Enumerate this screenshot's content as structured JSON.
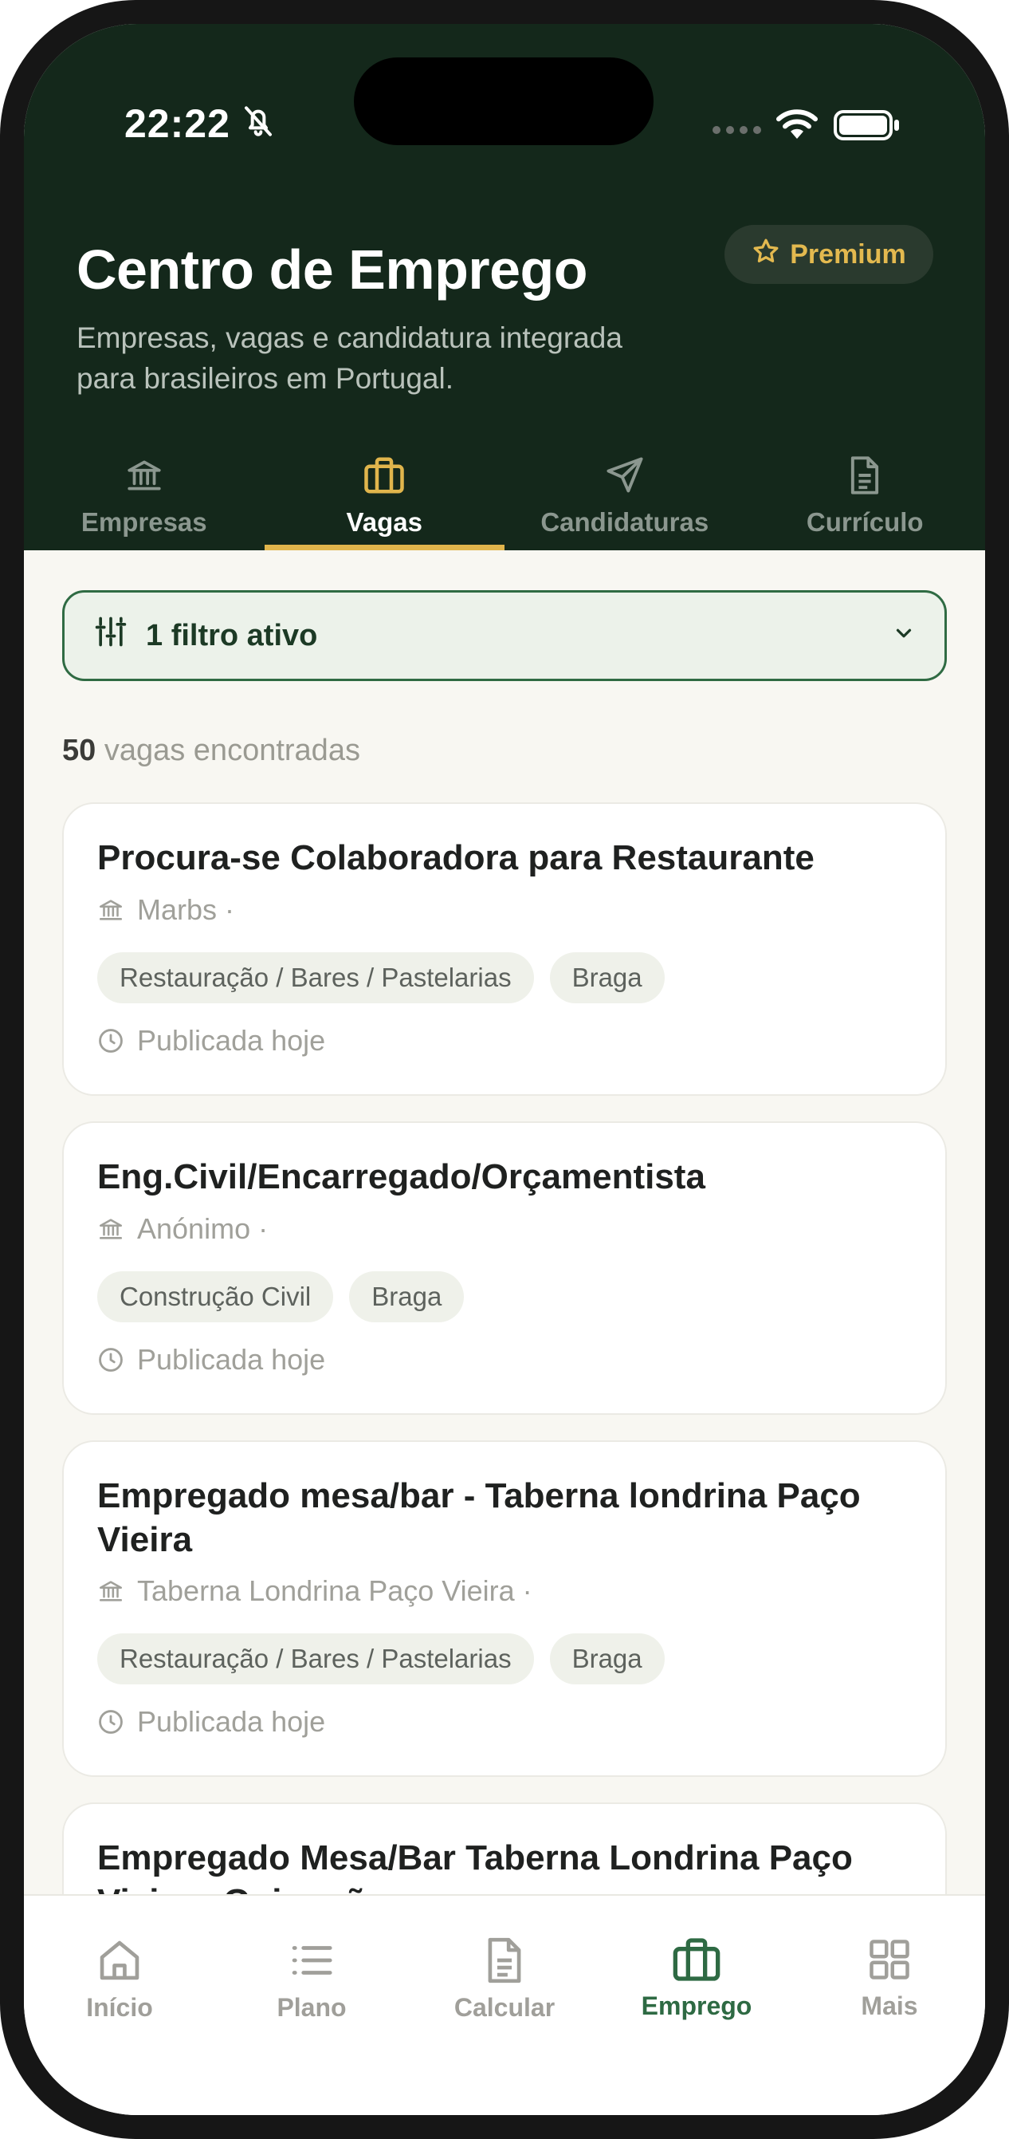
{
  "status_bar": {
    "time": "22:22"
  },
  "header": {
    "title": "Centro de Emprego",
    "subtitle": "Empresas, vagas e candidatura integrada para brasileiros em Portugal.",
    "premium_label": "Premium"
  },
  "tabs": [
    {
      "label": "Empresas",
      "icon": "bank-icon",
      "active": false
    },
    {
      "label": "Vagas",
      "icon": "briefcase-icon",
      "active": true
    },
    {
      "label": "Candidaturas",
      "icon": "send-icon",
      "active": false
    },
    {
      "label": "Currículo",
      "icon": "document-icon",
      "active": false
    }
  ],
  "filter": {
    "label": "1 filtro ativo"
  },
  "results": {
    "count": "50",
    "label": "vagas encontradas"
  },
  "jobs": [
    {
      "title": "Procura-se Colaboradora para Restaurante",
      "company": "Marbs ·",
      "tags": [
        "Restauração / Bares / Pastelarias",
        "Braga"
      ],
      "date": "Publicada hoje"
    },
    {
      "title": "Eng.Civil/Encarregado/Orçamentista",
      "company": "Anónimo ·",
      "tags": [
        "Construção Civil",
        "Braga"
      ],
      "date": "Publicada hoje"
    },
    {
      "title": "Empregado mesa/bar - Taberna londrina Paço Vieira",
      "company": "Taberna Londrina Paço Vieira ·",
      "tags": [
        "Restauração / Bares / Pastelarias",
        "Braga"
      ],
      "date": "Publicada hoje"
    },
    {
      "title": "Empregado Mesa/Bar Taberna Londrina Paço Vieira - Guimarães"
    }
  ],
  "bottom_nav": [
    {
      "label": "Início",
      "icon": "home-icon",
      "active": false
    },
    {
      "label": "Plano",
      "icon": "list-icon",
      "active": false
    },
    {
      "label": "Calcular",
      "icon": "document-icon",
      "active": false
    },
    {
      "label": "Emprego",
      "icon": "briefcase-icon",
      "active": true
    },
    {
      "label": "Mais",
      "icon": "grid-icon",
      "active": false
    }
  ],
  "colors": {
    "header_bg": "#14281b",
    "accent_gold": "#e0b54c",
    "accent_green": "#2e6a43",
    "page_bg": "#f8f7f2"
  }
}
